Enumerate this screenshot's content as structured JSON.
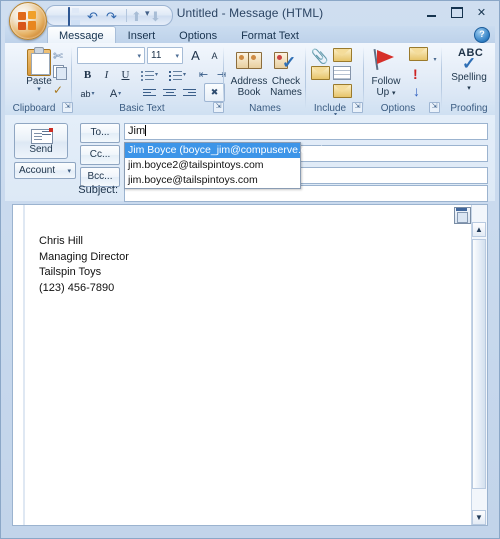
{
  "window": {
    "title": "Untitled  -  Message (HTML)",
    "minimize_label": "Minimize",
    "maximize_label": "Maximize",
    "close_label": "✕",
    "help_label": "?"
  },
  "quick_access": {
    "save": "save-icon",
    "undo": "↶",
    "redo": "↷",
    "previous": "⬆",
    "next": "⬇",
    "customize": "≡"
  },
  "ribbon": {
    "tabs": [
      {
        "label": "Message",
        "active": true
      },
      {
        "label": "Insert",
        "active": false
      },
      {
        "label": "Options",
        "active": false
      },
      {
        "label": "Format Text",
        "active": false
      }
    ],
    "groups": {
      "clipboard": {
        "label": "Clipboard",
        "paste_label": "Paste",
        "cut_label": "Cut",
        "copy_label": "Copy",
        "format_painter_label": "Format Painter",
        "dialog_launcher": "↘"
      },
      "basic_text": {
        "label": "Basic Text",
        "font_name": "",
        "font_size": "11",
        "grow_font": "A",
        "shrink_font": "A",
        "bold": "B",
        "italic": "I",
        "underline": "U",
        "bullets": "Bullets",
        "numbering": "Numbering",
        "decrease_indent": "Decrease Indent",
        "increase_indent": "Increase Indent",
        "highlight": "ab",
        "font_color": "A",
        "align_left": "Align Left",
        "align_center": "Center",
        "align_right": "Align Right",
        "clear_formatting": "Clear Formatting",
        "dialog_launcher": "↘"
      },
      "names": {
        "label": "Names",
        "address_book": "Address\nBook",
        "address_book_line1": "Address",
        "address_book_line2": "Book",
        "check_names_line1": "Check",
        "check_names_line2": "Names"
      },
      "include": {
        "label": "Include",
        "attach_file": "Attach File",
        "business_card": "Business Card",
        "attach_item": "Attach Item",
        "calendar": "Calendar",
        "signature": "Signature",
        "dialog_launcher": "↘"
      },
      "options": {
        "label": "Options",
        "follow_up_line1": "Follow",
        "follow_up_line2": "Up",
        "permission": "Permission",
        "high_importance": "!",
        "low_importance": "↓",
        "dialog_launcher": "↘"
      },
      "proofing": {
        "label": "Proofing",
        "spelling_abc": "ABC",
        "spelling_label": "Spelling"
      }
    }
  },
  "header": {
    "send_label": "Send",
    "account_label": "Account",
    "account_caret": "▼",
    "to_label": "To...",
    "cc_label": "Cc...",
    "bcc_label": "Bcc...",
    "subject_label": "Subject:",
    "to_value": "Jim",
    "cc_value": "",
    "bcc_value": "",
    "subject_value": "",
    "autocomplete": {
      "items": [
        {
          "text": "Jim Boyce (boyce_jim@compuserve.com)",
          "selected": true
        },
        {
          "text": "jim.boyce2@tailspintoys.com",
          "selected": false
        },
        {
          "text": "jim.boyce@tailspintoys.com",
          "selected": false
        }
      ],
      "highlight_color": "#3d95e8"
    }
  },
  "body": {
    "lines": [
      "Chris Hill",
      "Managing Director",
      "Tailspin Toys",
      "(123) 456-7890"
    ],
    "paste_options_tag": "paste-options-icon",
    "scroll_up": "▲",
    "scroll_down": "▼"
  },
  "colors": {
    "frame": "#b9cde8",
    "ribbon_bg": "#e6eef8",
    "accent_blue": "#3d95e8",
    "text": "#1d334a"
  }
}
